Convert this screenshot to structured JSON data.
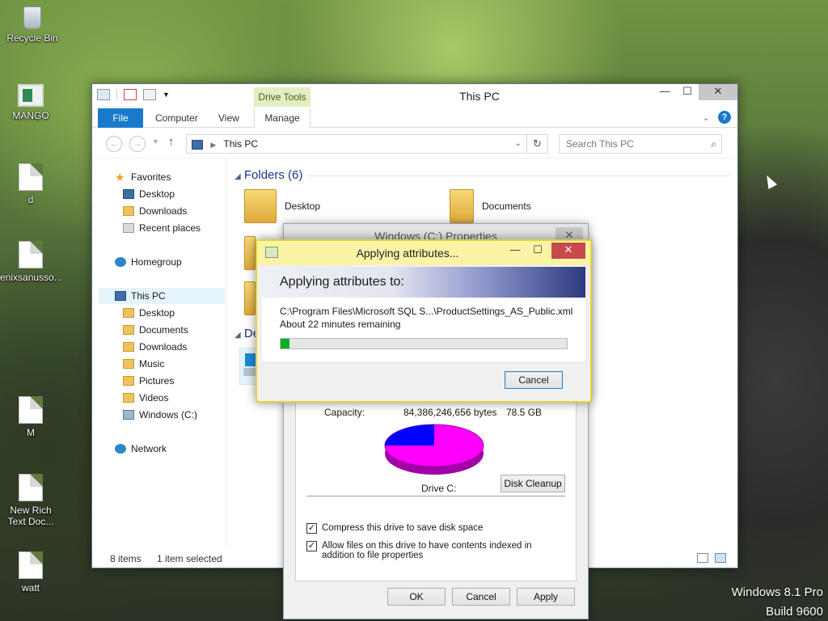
{
  "desktop": {
    "icons": [
      {
        "label": "Recycle Bin",
        "icon": "recycle-bin-icon"
      },
      {
        "label": "MANGO",
        "icon": "app-icon"
      },
      {
        "label": "d",
        "icon": "document-icon"
      },
      {
        "label": "enixsanusso...",
        "icon": "document-icon"
      },
      {
        "label": "M",
        "icon": "document-icon"
      },
      {
        "label": "New Rich Text Doc...",
        "icon": "rich-text-document-icon"
      },
      {
        "label": "watt",
        "icon": "document-icon"
      }
    ],
    "os_name": "Windows 8.1 Pro",
    "os_build": "Build 9600"
  },
  "explorer": {
    "title": "This PC",
    "contextual_tab_group": "Drive Tools",
    "tabs": {
      "file": "File",
      "computer": "Computer",
      "view": "View",
      "manage": "Manage"
    },
    "address": "This PC",
    "search_placeholder": "Search This PC",
    "nav": {
      "favorites": "Favorites",
      "fav_items": [
        "Desktop",
        "Downloads",
        "Recent places"
      ],
      "homegroup": "Homegroup",
      "this_pc": "This PC",
      "pc_items": [
        "Desktop",
        "Documents",
        "Downloads",
        "Music",
        "Pictures",
        "Videos",
        "Windows (C:)"
      ],
      "network": "Network"
    },
    "folders_header": "Folders (6)",
    "devices_header_partial": "De",
    "folder_tiles": [
      "Desktop",
      "Documents"
    ],
    "status": {
      "items": "8 items",
      "selected": "1 item selected"
    }
  },
  "properties": {
    "title": "Windows (C:) Properties",
    "capacity_label": "Capacity:",
    "capacity_bytes": "84,386,246,656 bytes",
    "capacity_gb": "78.5 GB",
    "drive_label": "Drive C:",
    "disk_cleanup": "Disk Cleanup",
    "compress_label": "Compress this drive to save disk space",
    "index_label": "Allow files on this drive to have contents indexed in addition to file properties",
    "ok": "OK",
    "cancel": "Cancel",
    "apply": "Apply",
    "used_color": "#ff00ff",
    "free_color": "#0000ff"
  },
  "apply_dialog": {
    "title": "Applying attributes...",
    "heading": "Applying attributes to:",
    "path": "C:\\Program Files\\Microsoft SQL S...\\ProductSettings_AS_Public.xml",
    "remaining": "About 22 minutes remaining",
    "progress_fraction": 0.03,
    "cancel": "Cancel"
  }
}
